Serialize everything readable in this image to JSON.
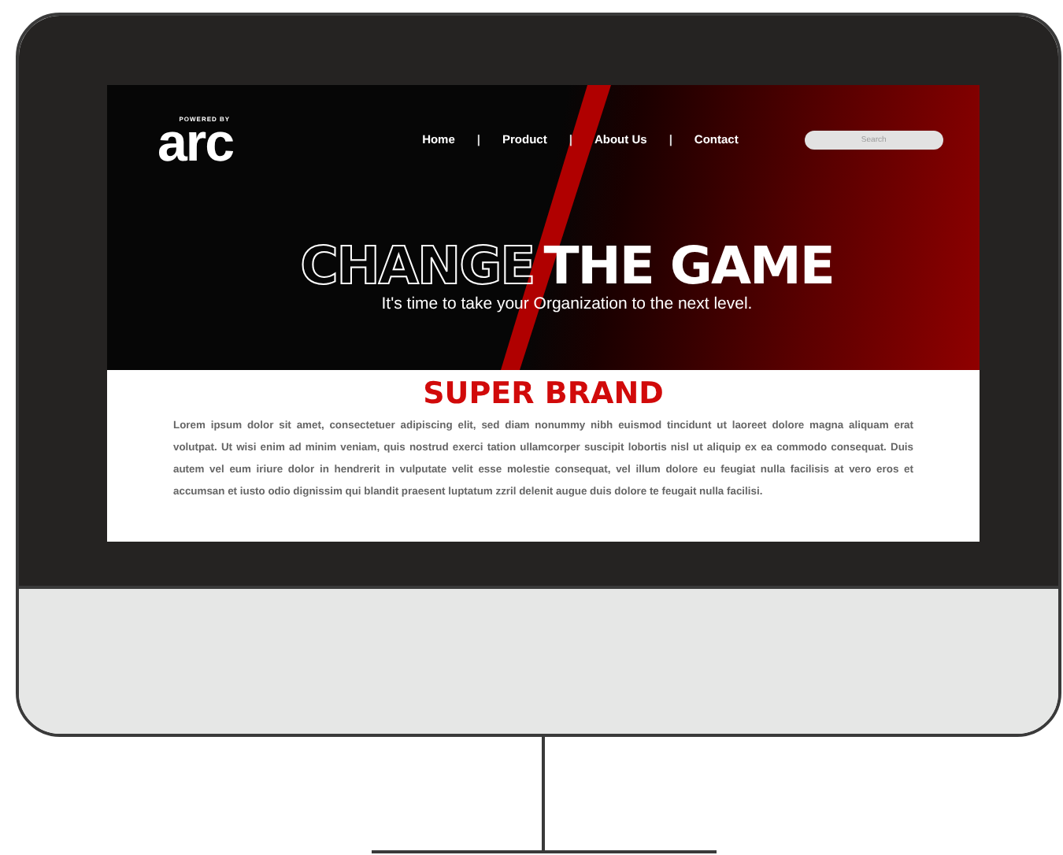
{
  "site": {
    "logo_tagline": "POWERED BY",
    "logo": "arc"
  },
  "nav": [
    {
      "kind": "link",
      "label": "Home"
    },
    {
      "kind": "separator",
      "label": "|"
    },
    {
      "kind": "link",
      "label": "Product"
    },
    {
      "kind": "separator",
      "label": "|"
    },
    {
      "kind": "link",
      "label": "About Us"
    },
    {
      "kind": "separator",
      "label": "|"
    },
    {
      "kind": "link",
      "label": "Contact"
    }
  ],
  "search": {
    "placeholder": "Search"
  },
  "hero": {
    "headline_outlined": "CHANGE",
    "headline_solid": "THE GAME",
    "subtitle": "It's time to take your Organization to the next level."
  },
  "section": {
    "title": "SUPER BRAND",
    "body": "Lorem ipsum dolor sit amet, consectetuer adipiscing elit, sed diam nonummy nibh euismod tincidunt ut laoreet dolore magna aliquam erat volutpat. Ut wisi enim ad minim veniam, quis nostrud exerci tation ullamcorper suscipit lobortis nisl ut aliquip ex ea commodo consequat. Duis autem vel eum iriure dolor in hendrerit in vulputate velit esse molestie consequat, vel illum dolore eu feugiat nulla facilisis at vero eros et accumsan et iusto odio dignissim qui blandit praesent luptatum zzril delenit augue duis dolore te feugait nulla facilisi."
  }
}
